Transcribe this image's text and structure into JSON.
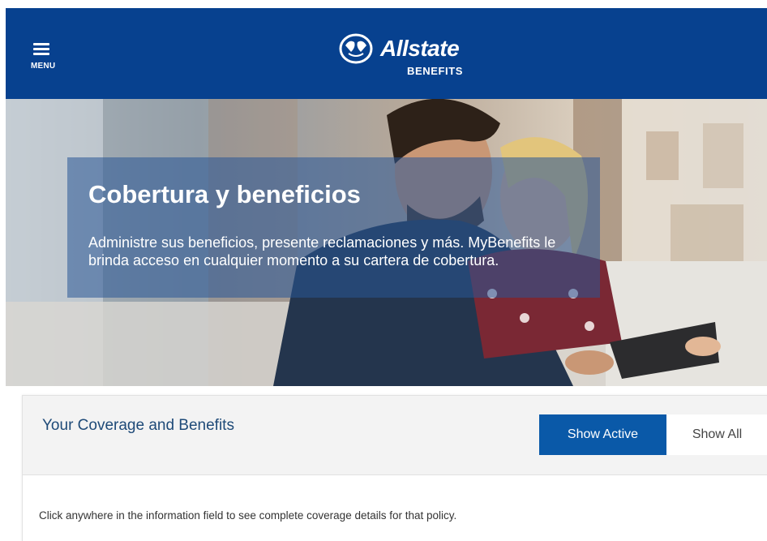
{
  "header": {
    "menu_label": "MENU",
    "logo_name": "Allstate",
    "logo_sub": "BENEFITS",
    "background_color": "#07418f"
  },
  "hero": {
    "title": "Cobertura y beneficios",
    "description": "Administre sus beneficios, presente reclamaciones y más. MyBenefits le brinda acceso en cualquier momento a su cartera de cobertura."
  },
  "coverage": {
    "title": "Your Coverage and Benefits",
    "show_active_label": "Show Active",
    "show_all_label": "Show All",
    "active_filter": "Show Active",
    "info_text": "Click anywhere in the information field to see complete coverage details for that policy.",
    "accent_color": "#0a59a8"
  },
  "icons": {
    "menu": "hamburger-menu-icon",
    "logo": "allstate-hands-logo"
  }
}
